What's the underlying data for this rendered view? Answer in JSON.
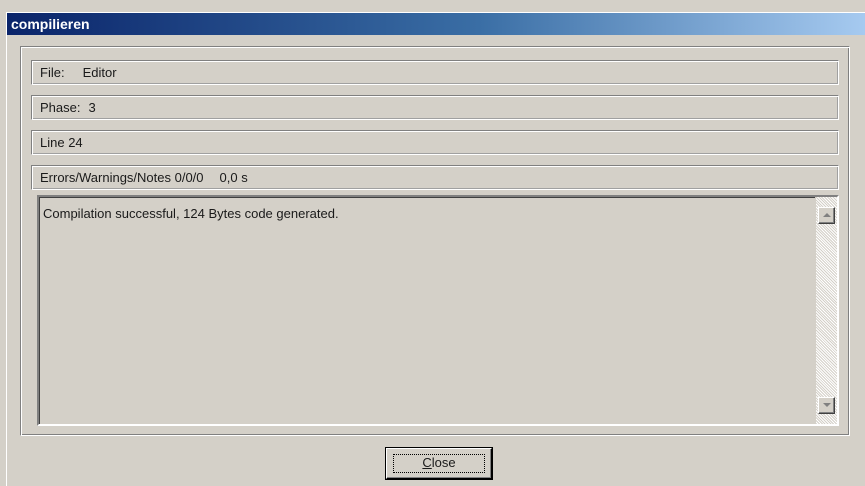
{
  "window": {
    "title": "compilieren"
  },
  "fields": {
    "file_label": "File:",
    "file_value": "Editor",
    "phase_label": "Phase:",
    "phase_value": "3",
    "line_text": "Line 24",
    "errors_label": "Errors/Warnings/Notes 0/0/0",
    "time_value": "0,0 s"
  },
  "output": {
    "message": "Compilation successful, 124 Bytes code generated."
  },
  "buttons": {
    "close_mnemonic": "C",
    "close_rest": "lose"
  },
  "icons": {
    "scroll_up": "scroll-up-arrow",
    "scroll_down": "scroll-down-arrow"
  },
  "colors": {
    "title_start": "#0a246a",
    "title_end": "#a6caf0",
    "face": "#d4d0c8"
  }
}
